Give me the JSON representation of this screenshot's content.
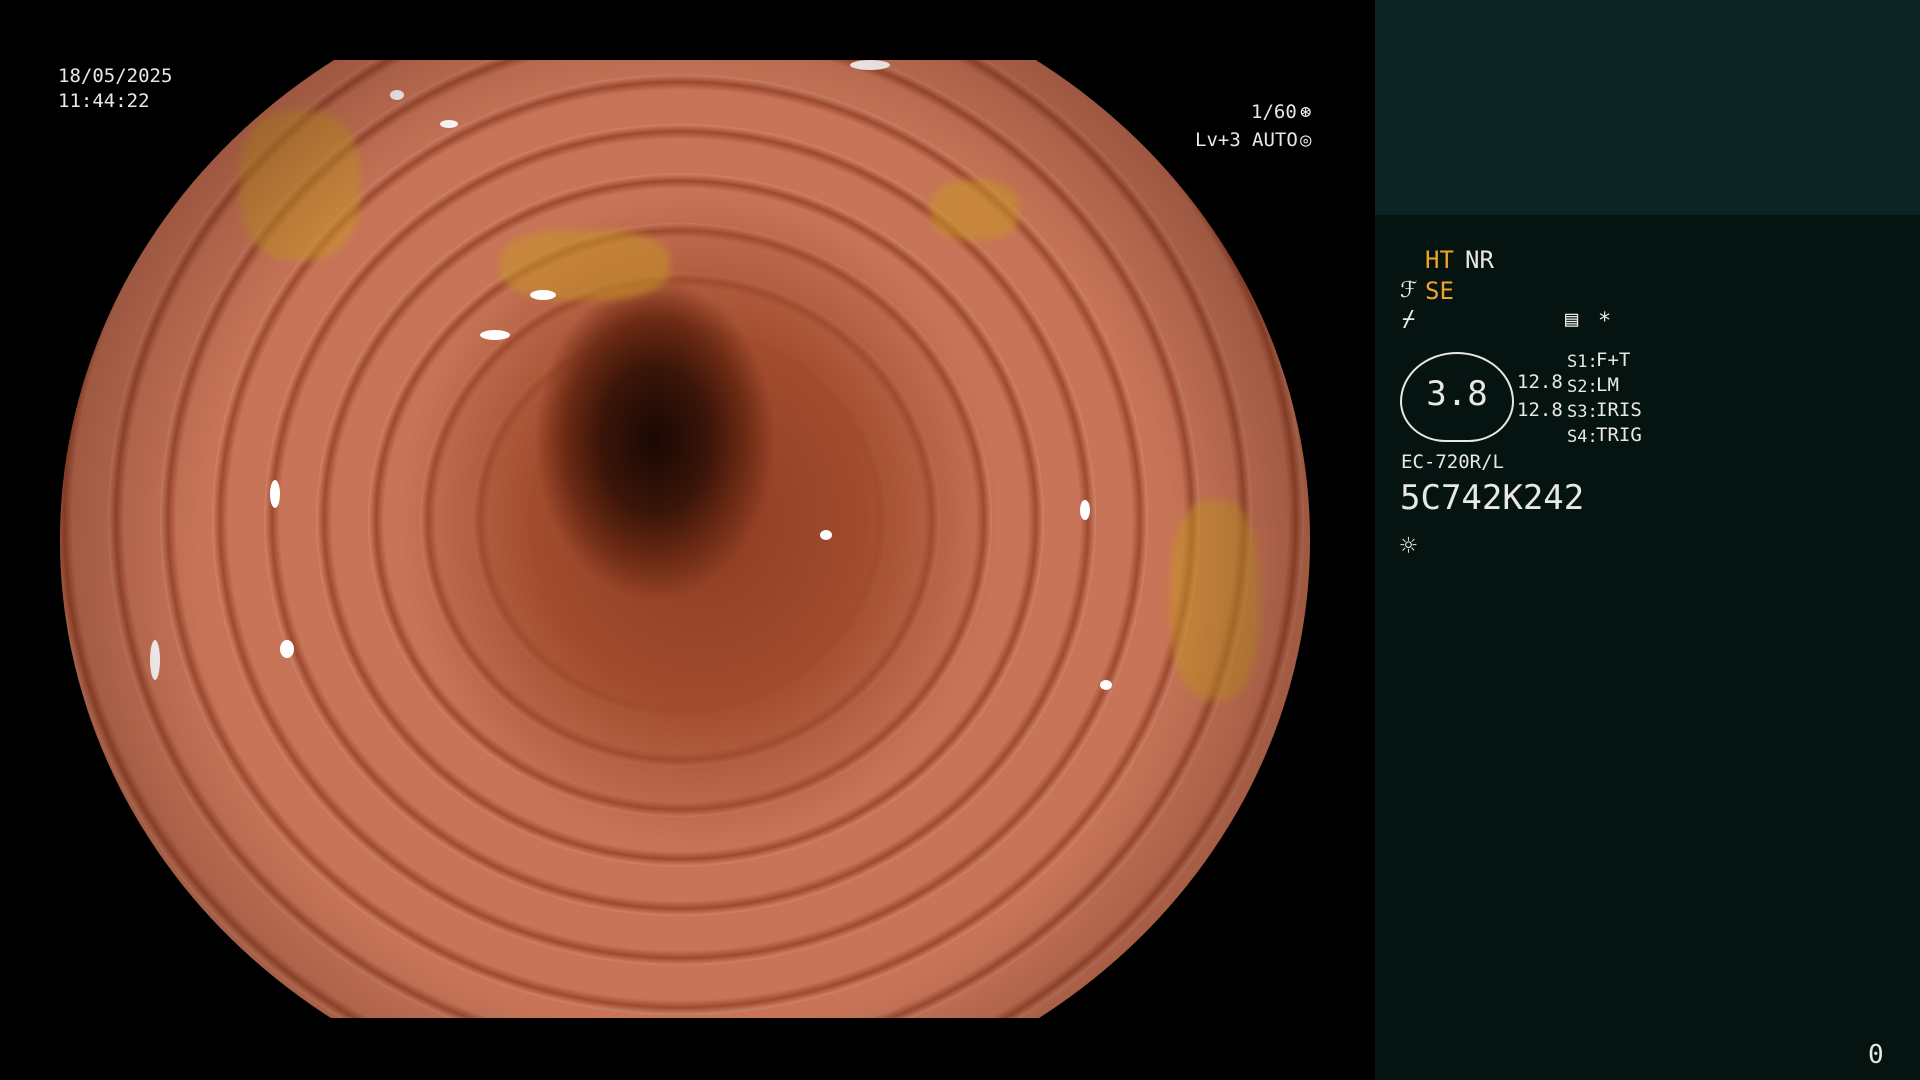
{
  "overlay": {
    "date": "18/05/2025",
    "time": "11:44:22",
    "shutter": "1/60",
    "shutter_icon": "aperture-icon",
    "level": "Lv+3",
    "mode": "AUTO",
    "mode_icon": "auto-iris-icon"
  },
  "panel": {
    "ht": "HT",
    "nr": "NR",
    "se": "SE",
    "structure_icon": "structure-enhance-icon",
    "freeze_icon": "freeze-icon",
    "memory_icon": "memory-card-icon",
    "asterisk": "*",
    "gauge_value": "3.8",
    "left_value_1": "12.8",
    "left_value_2": "12.8",
    "switches": [
      {
        "key": "S1:",
        "value": "F+T"
      },
      {
        "key": "S2:",
        "value": "LM"
      },
      {
        "key": "S3:",
        "value": "IRIS"
      },
      {
        "key": "S4:",
        "value": "TRIG"
      }
    ],
    "scope_model": "EC-720R/L",
    "serial": "5C742K242",
    "light_icon": "light-sun-icon",
    "counter": "0"
  },
  "colors": {
    "panel_bg": "#061411",
    "panel_top_bg": "#0c2524",
    "accent_orange": "#f0a22a"
  }
}
